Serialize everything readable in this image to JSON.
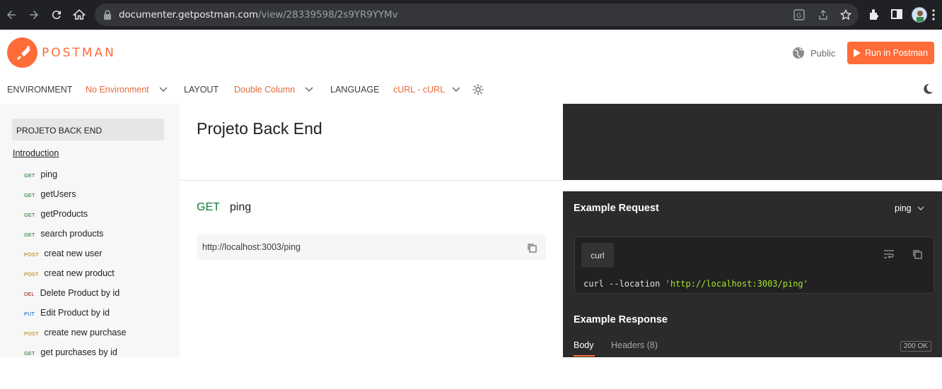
{
  "browser": {
    "url_host": "documenter.getpostman.com",
    "url_path": "/view/28339598/2s9YR9YYMv"
  },
  "header": {
    "brand": "POSTMAN",
    "visibility": "Public",
    "run_button": "Run in Postman"
  },
  "toolbar": {
    "environment_label": "ENVIRONMENT",
    "environment_value": "No Environment",
    "layout_label": "LAYOUT",
    "layout_value": "Double Column",
    "language_label": "LANGUAGE",
    "language_value": "cURL - cURL"
  },
  "sidebar": {
    "collection": "PROJETO BACK END",
    "intro": "Introduction",
    "requests": [
      {
        "method": "GET",
        "name": "ping"
      },
      {
        "method": "GET",
        "name": "getUsers"
      },
      {
        "method": "GET",
        "name": "getProducts"
      },
      {
        "method": "GET",
        "name": "search products"
      },
      {
        "method": "POST",
        "name": "creat new user"
      },
      {
        "method": "POST",
        "name": "creat new product"
      },
      {
        "method": "DEL",
        "name": "Delete Product by id"
      },
      {
        "method": "PUT",
        "name": "Edit Product by id"
      },
      {
        "method": "POST",
        "name": "create new purchase"
      },
      {
        "method": "GET",
        "name": "get purchases by id"
      }
    ]
  },
  "main": {
    "title": "Projeto Back End",
    "request_method": "GET",
    "request_name": "ping",
    "request_url": "http://localhost:3003/ping"
  },
  "example": {
    "request_title": "Example Request",
    "selector": "ping",
    "code_tab": "curl",
    "code_prefix": "curl --location ",
    "code_string": "'http://localhost:3003/ping'",
    "response_title": "Example Response",
    "tab_body": "Body",
    "tab_headers": "Headers (8)",
    "status": "200 OK"
  },
  "colors": {
    "brand": "#ff6c37",
    "dark_panel": "#2b2b2b",
    "get": "#0f6f2a",
    "post": "#ad7a03",
    "del": "#8e1a10",
    "put": "#0b5fcc"
  }
}
